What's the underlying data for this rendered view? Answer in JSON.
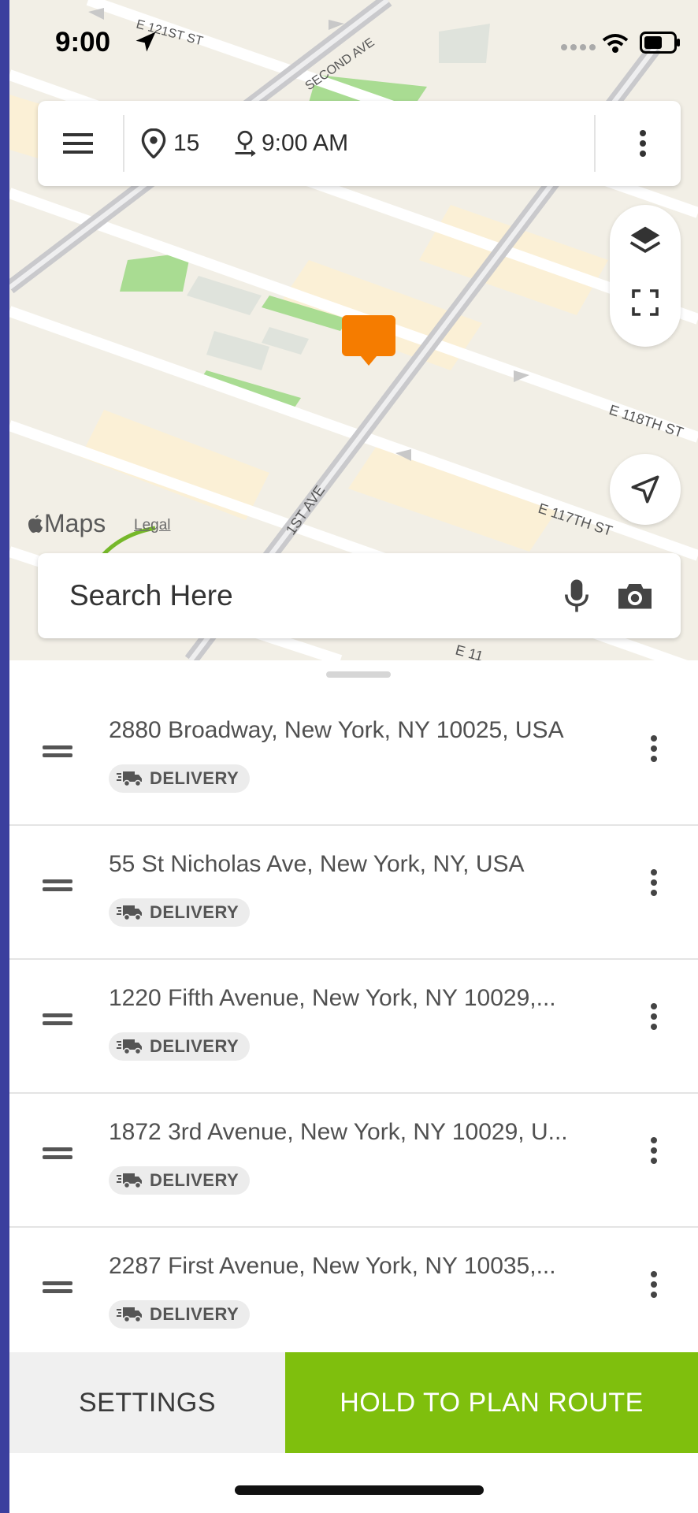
{
  "status_bar": {
    "time": "9:00"
  },
  "map": {
    "street_labels": [
      "E 121ST ST",
      "SECOND AVE",
      "1ST AVE",
      "E 118TH ST",
      "E 117TH ST",
      "E 11"
    ],
    "attribution": "Maps",
    "legal_link": "Legal",
    "marker_color": "#f57c00"
  },
  "top_bar": {
    "stops_count": "15",
    "start_time": "9:00 AM"
  },
  "search": {
    "placeholder": "Search Here"
  },
  "stops": [
    {
      "address": "2880 Broadway, New York, NY 10025, USA",
      "type": "DELIVERY"
    },
    {
      "address": "55 St Nicholas Ave, New York, NY, USA",
      "type": "DELIVERY"
    },
    {
      "address": "1220 Fifth Avenue, New York, NY 10029,...",
      "type": "DELIVERY"
    },
    {
      "address": "1872 3rd Avenue, New York, NY 10029, U...",
      "type": "DELIVERY"
    },
    {
      "address": "2287 First Avenue, New York, NY 10035,...",
      "type": "DELIVERY"
    }
  ],
  "footer": {
    "settings_label": "SETTINGS",
    "plan_label": "HOLD TO PLAN ROUTE"
  },
  "colors": {
    "accent": "#7fbf0d",
    "marker": "#f57c00",
    "edge": "#3b3f9e"
  }
}
